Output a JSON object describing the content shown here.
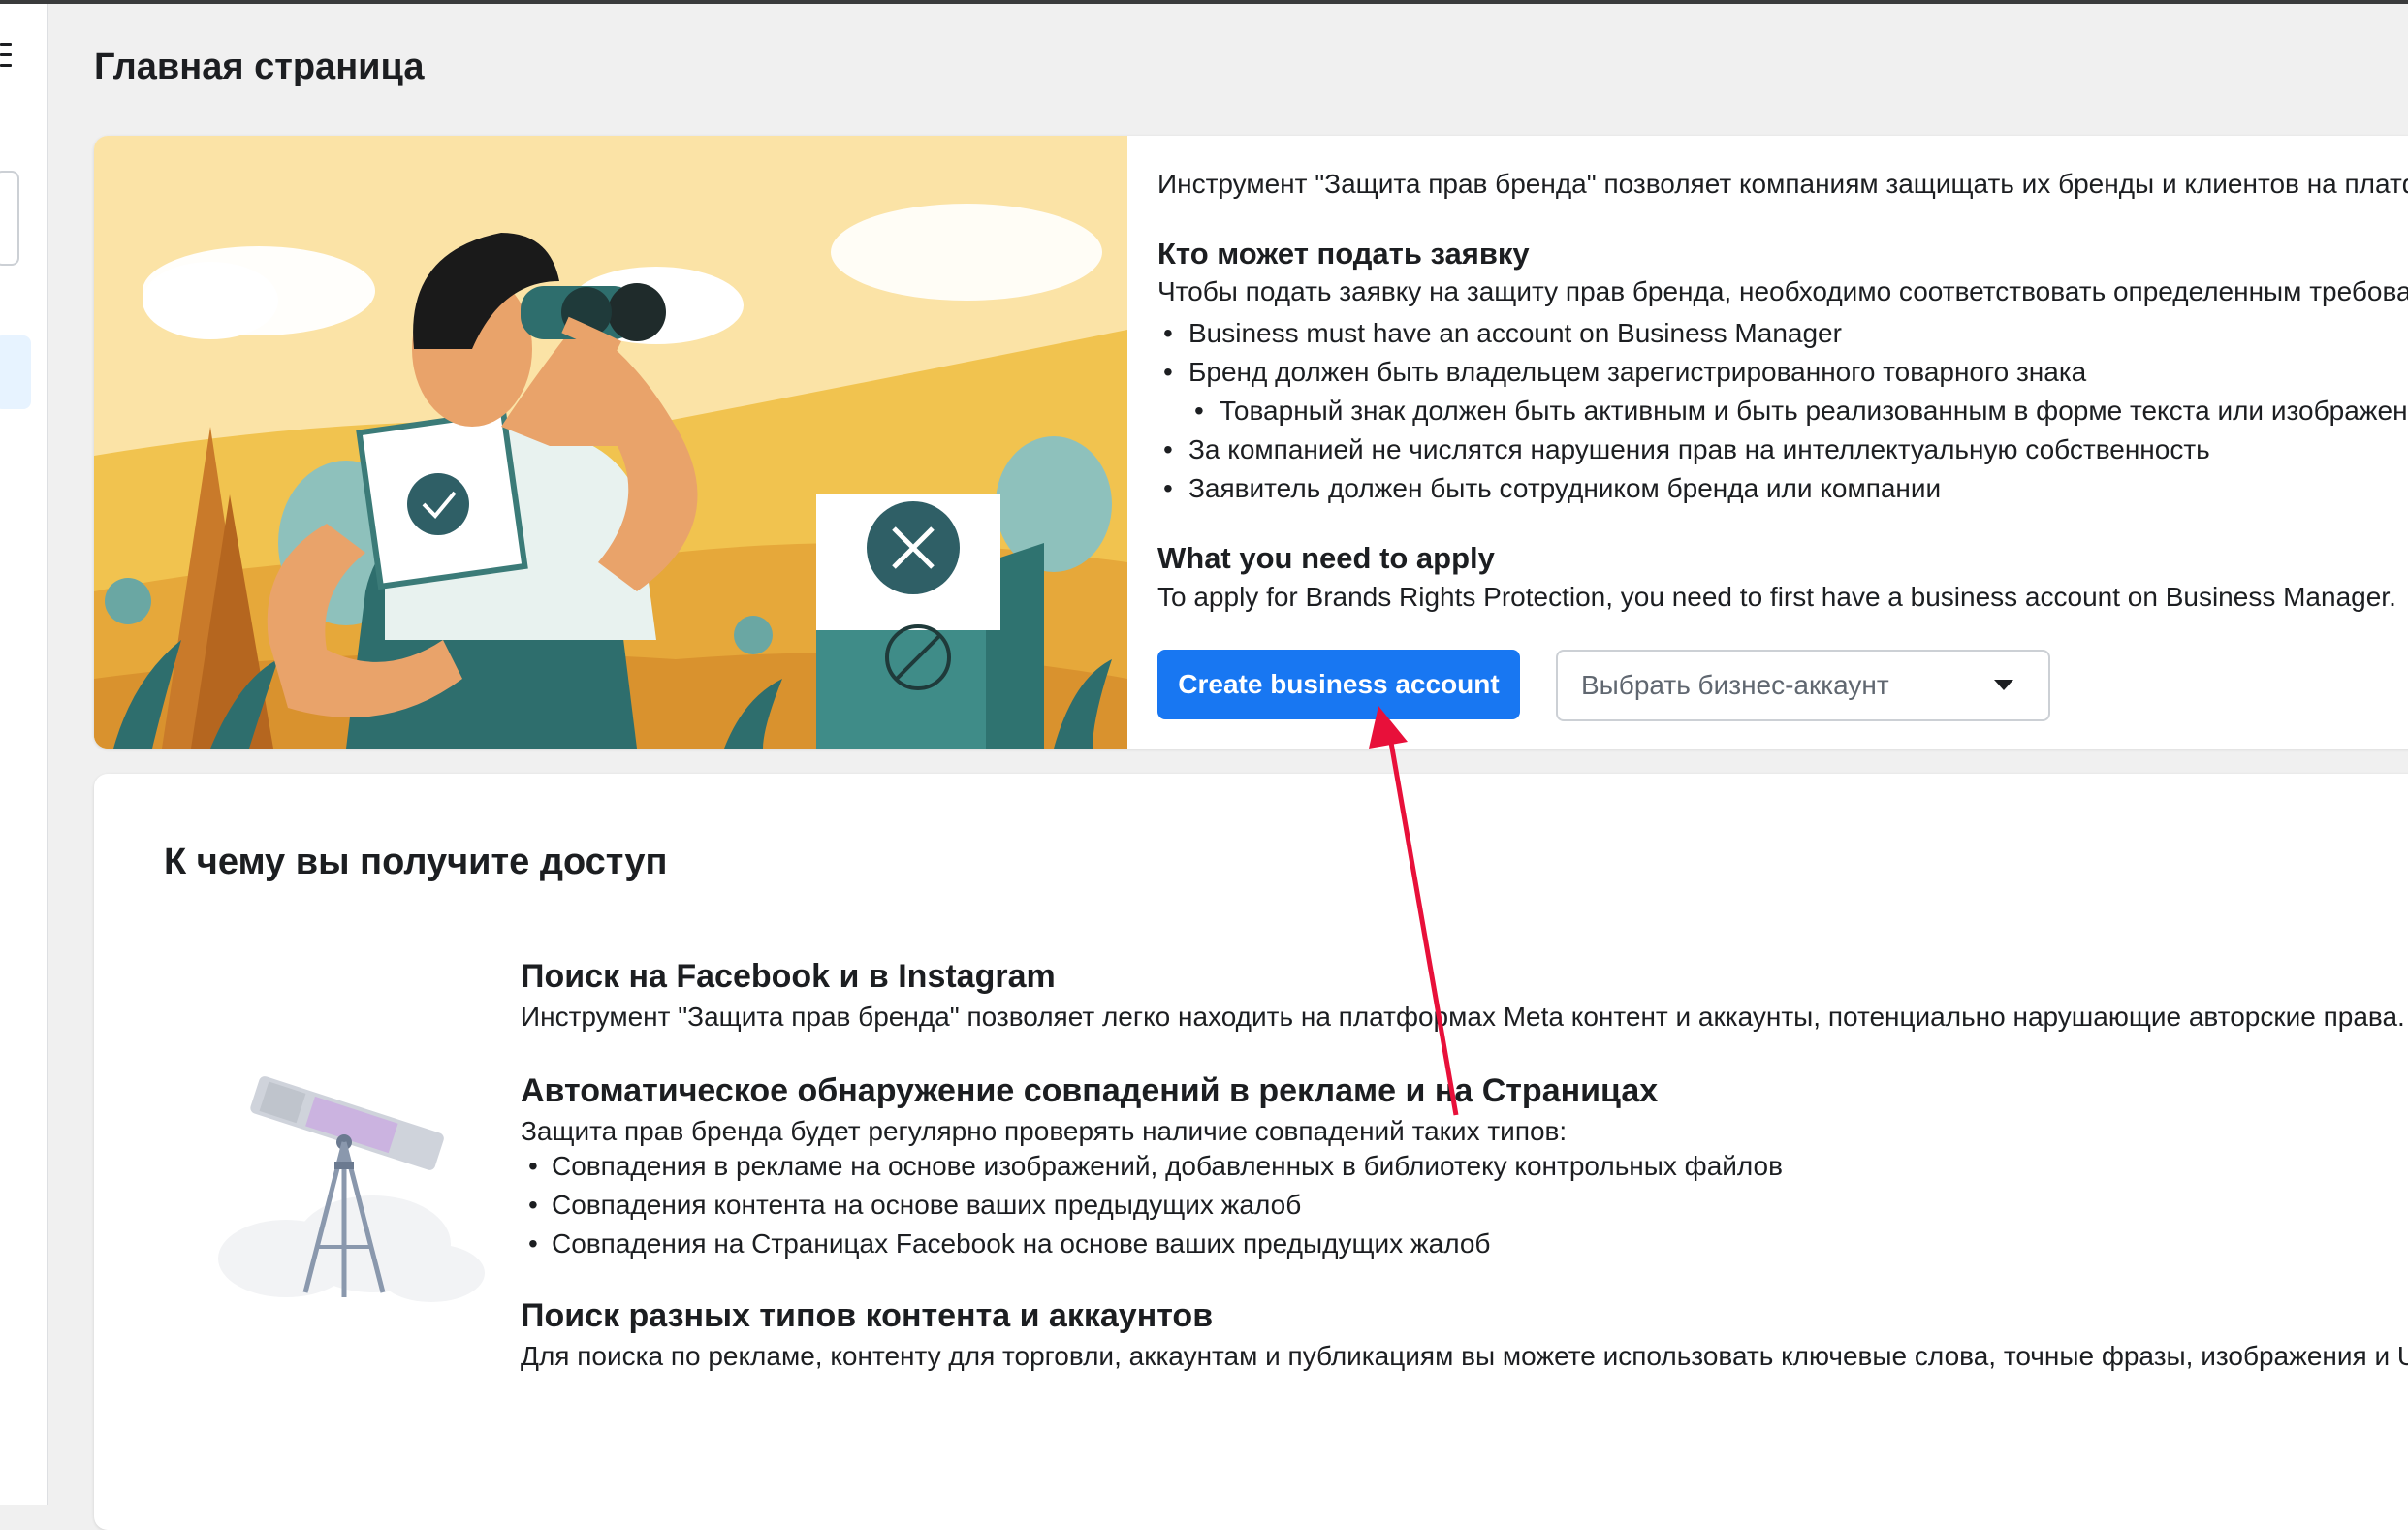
{
  "page": {
    "title": "Главная страница"
  },
  "hero": {
    "intro": "Инструмент \"Защита прав бренда\" позволяет компаниям защищать их бренды и клиентов на платф",
    "who_title": "Кто может подать заявку",
    "who_intro": "Чтобы подать заявку на защиту прав бренда, необходимо соответствовать определенным требован",
    "requirements": [
      "Business must have an account on Business Manager",
      "Бренд должен быть владельцем зарегистрированного товарного знака",
      "Товарный знак должен быть активным и быть реализованным в форме текста или изображени",
      "За компанией не числятся нарушения прав на интеллектуальную собственность",
      "Заявитель должен быть сотрудником бренда или компании"
    ],
    "need_title": "What you need to apply",
    "need_text": "To apply for Brands Rights Protection, you need to first have a business account on Business Manager.",
    "create_button": "Create business account",
    "select_placeholder": "Выбрать бизнес-аккаунт"
  },
  "access": {
    "title": "К чему вы получите доступ",
    "features": [
      {
        "title": "Поиск на Facebook и в Instagram",
        "text": "Инструмент \"Защита прав бренда\" позволяет легко находить на платформах Meta контент и аккаунты, потенциально нарушающие авторские права."
      },
      {
        "title": "Автоматическое обнаружение совпадений в рекламе и на Страницах",
        "text": "Защита прав бренда будет регулярно проверять наличие совпадений таких типов:",
        "items": [
          "Совпадения в рекламе на основе изображений, добавленных в библиотеку контрольных файлов",
          "Совпадения контента на основе ваших предыдущих жалоб",
          "Совпадения на Страницах Facebook на основе ваших предыдущих жалоб"
        ]
      },
      {
        "title": "Поиск разных типов контента и аккаунтов",
        "text": "Для поиска по рекламе, контенту для торговли, аккаунтам и публикациям вы можете использовать ключевые слова, точные фразы, изображения и UR"
      }
    ]
  },
  "colors": {
    "primary": "#1877f2",
    "annotation": "#e8103a"
  },
  "icons": {
    "menu": "hamburger-icon",
    "caret": "caret-down-icon",
    "telescope": "telescope-illustration"
  }
}
